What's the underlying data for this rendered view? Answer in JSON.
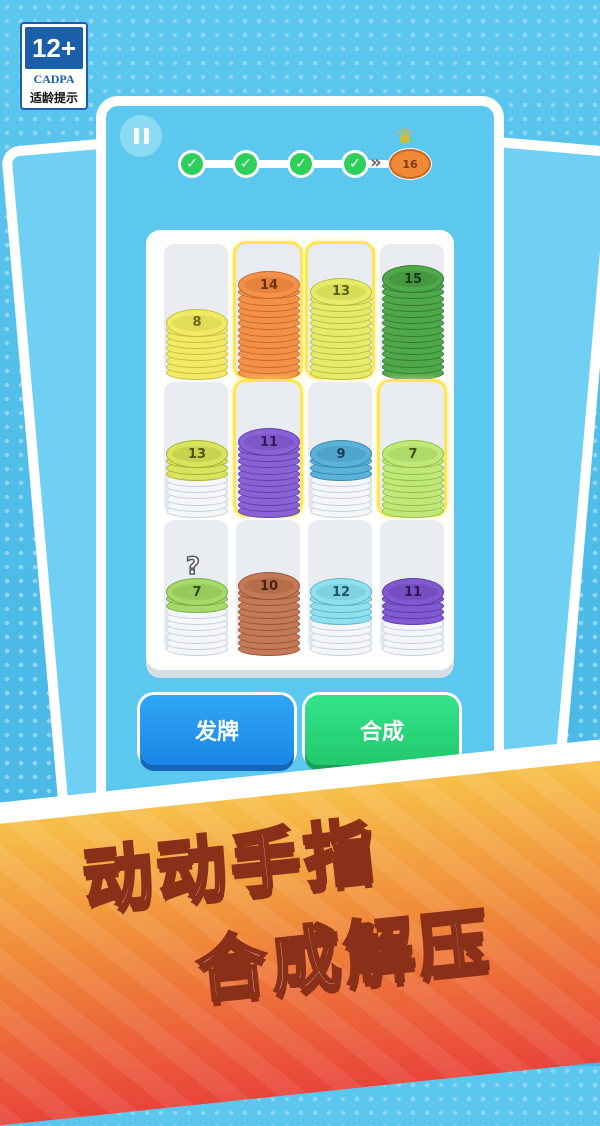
{
  "rating": {
    "age": "12+",
    "org": "CADPA",
    "tip": "适龄提示"
  },
  "progress": {
    "completed": 4,
    "goal_value": "16"
  },
  "slots": [
    {
      "n": "8",
      "color": "#f2ea66",
      "dark": "#c7bf3a",
      "text": "#6e6620",
      "layers": 8,
      "sel": false
    },
    {
      "n": "14",
      "color": "#f39149",
      "dark": "#c86a28",
      "text": "#6a3010",
      "layers": 14,
      "sel": true
    },
    {
      "n": "13",
      "color": "#e6ec6a",
      "dark": "#b8bf3a",
      "text": "#5d601a",
      "layers": 13,
      "sel": true
    },
    {
      "n": "15",
      "color": "#4fa84a",
      "dark": "#357c31",
      "text": "#183a15",
      "layers": 15,
      "sel": false
    },
    {
      "n": "13",
      "color": "#d8e35e",
      "dark": "#a8b334",
      "text": "#4f5618",
      "layers": 3,
      "sel": false,
      "grey": 6
    },
    {
      "n": "11",
      "color": "#8a62d6",
      "dark": "#6340ad",
      "text": "#2e1c58",
      "layers": 11,
      "sel": true
    },
    {
      "n": "9",
      "color": "#5ab2d8",
      "dark": "#3b88ad",
      "text": "#164058",
      "layers": 3,
      "sel": false,
      "grey": 6
    },
    {
      "n": "7",
      "color": "#bfe878",
      "dark": "#90bf4c",
      "text": "#3d5618",
      "layers": 9,
      "sel": true
    },
    {
      "n": "7",
      "color": "#a6d86a",
      "dark": "#78ad40",
      "text": "#2f4a14",
      "layers": 2,
      "sel": false,
      "grey": 7,
      "question": "?"
    },
    {
      "n": "10",
      "color": "#c47a56",
      "dark": "#9a5434",
      "text": "#4a2010",
      "layers": 10,
      "sel": false
    },
    {
      "n": "12",
      "color": "#8fe0ee",
      "dark": "#5cb4c8",
      "text": "#1f5460",
      "layers": 4,
      "sel": false,
      "grey": 5
    },
    {
      "n": "11",
      "color": "#8159d0",
      "dark": "#5e3ba8",
      "text": "#2b1a55",
      "layers": 4,
      "sel": false,
      "grey": 5
    }
  ],
  "buttons": {
    "deal": "发牌",
    "merge": "合成"
  },
  "slogan": {
    "line1": "动动手指",
    "line2": "合成解压"
  },
  "colors": {
    "check": "#2ecf5a",
    "deal": "#1c86e6",
    "merge": "#22c96c"
  }
}
